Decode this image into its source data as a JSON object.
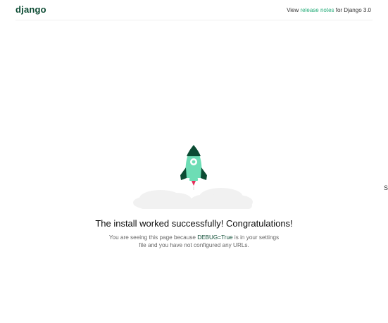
{
  "header": {
    "logo": "django",
    "release_prefix": "View ",
    "release_link": "release notes",
    "release_suffix": " for Django 3.0"
  },
  "main": {
    "title": "The install worked successfully! Congratulations!",
    "desc_1": "You are seeing this page because ",
    "debug_setting": "DEBUG=True",
    "desc_2": " is in your settings file and you have not configured any URLs."
  },
  "edge_text": "S",
  "colors": {
    "brand": "#0c4b33",
    "accent": "#20aa76",
    "rocket": "#6dddb5",
    "cloud": "#f0f0f0"
  },
  "icons": {
    "rocket": "rocket-icon",
    "clouds": "cloud-icon"
  }
}
